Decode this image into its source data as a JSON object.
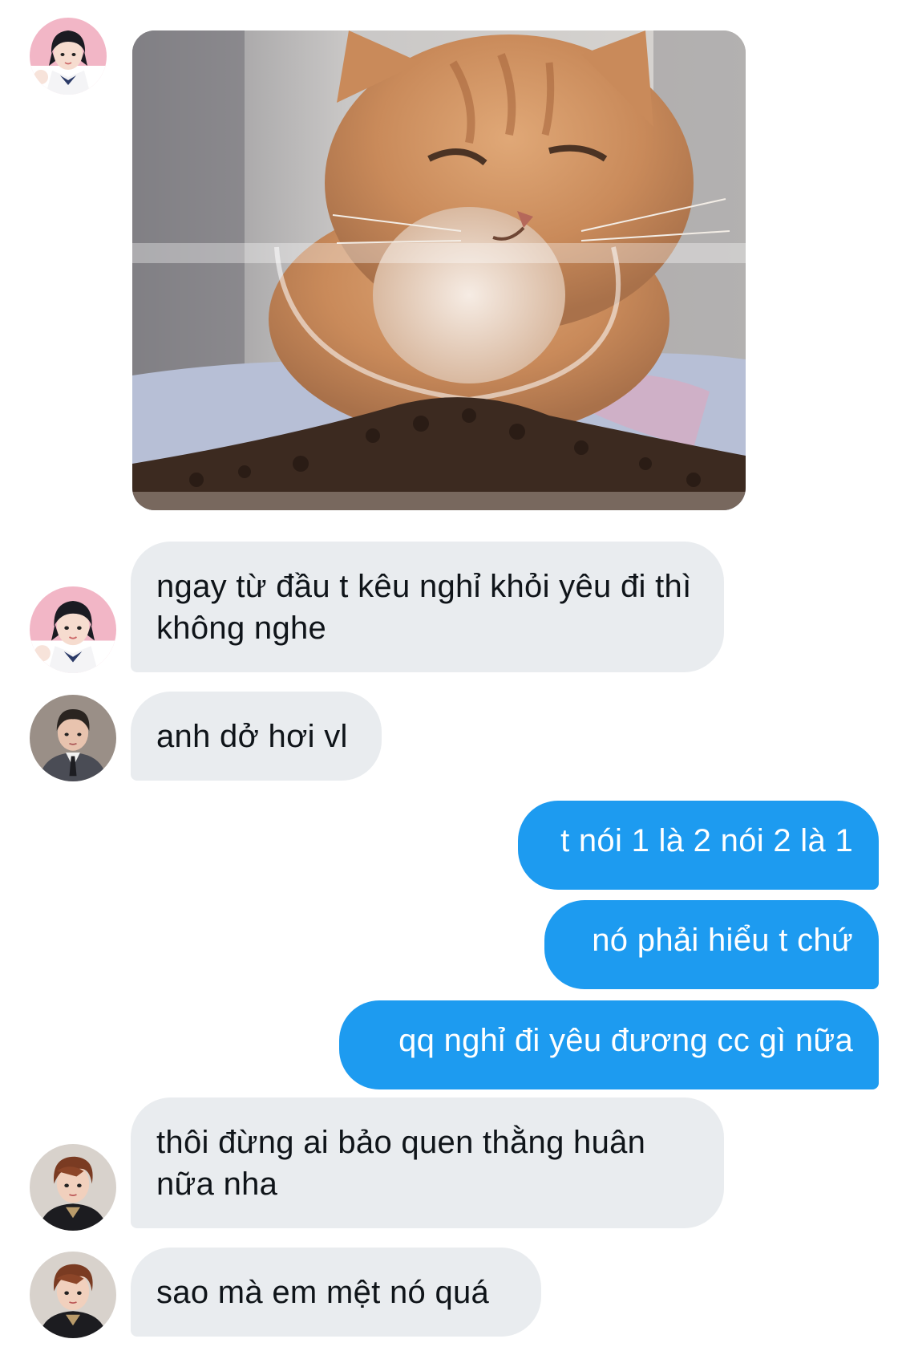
{
  "messages": [
    {
      "id": "m1",
      "side": "incoming",
      "text": "ngay từ đầu t kêu nghỉ khỏi yêu đi thì không nghe"
    },
    {
      "id": "m2",
      "side": "incoming",
      "text": "anh dở hơi vl"
    },
    {
      "id": "m3",
      "side": "outgoing",
      "text": "t nói 1 là 2 nói 2 là 1"
    },
    {
      "id": "m4",
      "side": "outgoing",
      "text": "nó phải hiểu t chứ"
    },
    {
      "id": "m5",
      "side": "outgoing",
      "text": "qq nghỉ đi yêu đương cc gì nữa"
    },
    {
      "id": "m6",
      "side": "incoming",
      "text": "thôi đừng ai bảo quen thằng huân nữa nha"
    },
    {
      "id": "m7",
      "side": "incoming",
      "text": "sao mà em mệt nó quá"
    }
  ],
  "media": {
    "type": "image",
    "subject": "orange-cat-photo"
  },
  "colors": {
    "incoming_bubble": "#e9ecef",
    "outgoing_bubble": "#1d9bf0",
    "incoming_text": "#0f1419",
    "outgoing_text": "#ffffff"
  }
}
